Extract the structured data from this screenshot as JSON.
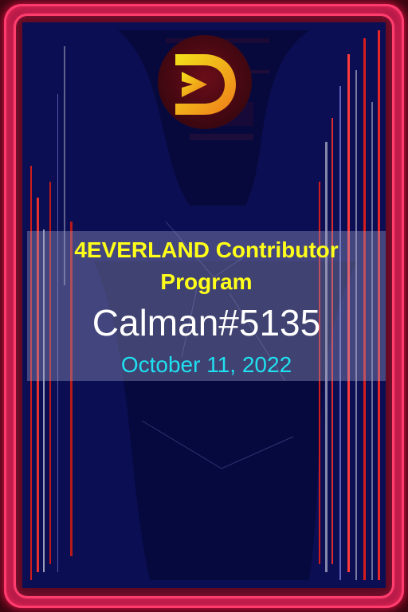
{
  "card": {
    "program_title": "4EVERLAND Contributor Program",
    "recipient": "Calman#5135",
    "date": "October 11, 2022"
  },
  "logo": {
    "icon": "4everland-logo-icon"
  },
  "colors": {
    "frame": "#ff3d6e",
    "background": "#0c0f54",
    "title": "#ffff1a",
    "name": "#ffffff",
    "date": "#1fe0f0"
  }
}
